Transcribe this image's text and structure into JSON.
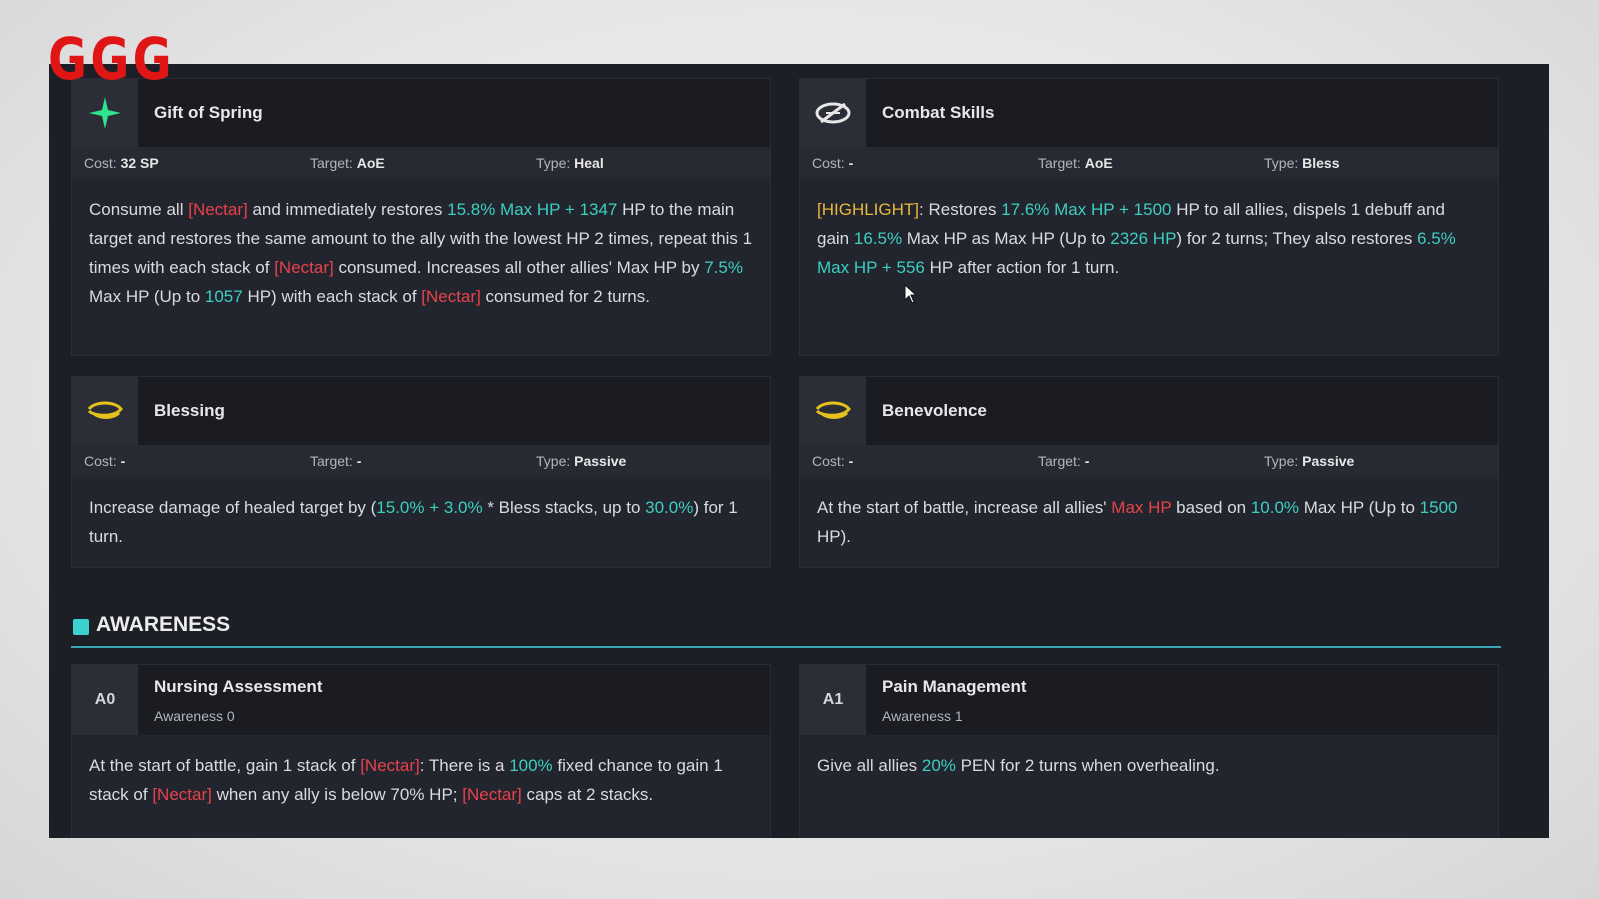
{
  "watermark": "GGG",
  "skills": [
    {
      "icon": "green-sparkle-icon",
      "title": "Gift of Spring",
      "cost_label": "Cost:",
      "cost": "32 SP",
      "target_label": "Target:",
      "target": "AoE",
      "type_label": "Type:",
      "type": "Heal",
      "desc": [
        {
          "t": "Consume all "
        },
        {
          "t": "[Nectar]",
          "c": "r"
        },
        {
          "t": " and immediately restores "
        },
        {
          "t": "15.8% Max HP + 1347",
          "c": "g"
        },
        {
          "t": " HP to the main target and restores the same amount to the ally with the lowest HP 2 times, repeat this 1 times with each stack of "
        },
        {
          "t": "[Nectar]",
          "c": "r"
        },
        {
          "t": " consumed. Increases all other allies' Max HP by "
        },
        {
          "t": "7.5%",
          "c": "g"
        },
        {
          "t": " Max HP (Up to "
        },
        {
          "t": "1057",
          "c": "g"
        },
        {
          "t": " HP) with each stack of "
        },
        {
          "t": "[Nectar]",
          "c": "r"
        },
        {
          "t": " consumed for 2 turns."
        }
      ]
    },
    {
      "icon": "crossed-target-icon",
      "title": "Combat Skills",
      "cost_label": "Cost:",
      "cost": "-",
      "target_label": "Target:",
      "target": "AoE",
      "type_label": "Type:",
      "type": "Bless",
      "desc": [
        {
          "t": "[HIGHLIGHT]",
          "c": "y"
        },
        {
          "t": ": Restores "
        },
        {
          "t": "17.6% Max HP + 1500",
          "c": "g"
        },
        {
          "t": " HP to all allies, dispels 1 debuff and gain "
        },
        {
          "t": "16.5%",
          "c": "g"
        },
        {
          "t": " Max HP as Max HP (Up to "
        },
        {
          "t": "2326 HP",
          "c": "g"
        },
        {
          "t": ") for 2 turns; They also restores "
        },
        {
          "t": "6.5% Max HP + 556",
          "c": "g"
        },
        {
          "t": " HP after action for 1 turn."
        }
      ]
    },
    {
      "icon": "yellow-loop-icon",
      "title": "Blessing",
      "cost_label": "Cost:",
      "cost": "-",
      "target_label": "Target:",
      "target": "-",
      "type_label": "Type:",
      "type": "Passive",
      "desc": [
        {
          "t": "Increase damage of healed target by ("
        },
        {
          "t": "15.0% + 3.0%",
          "c": "g"
        },
        {
          "t": " * Bless stacks, up to "
        },
        {
          "t": "30.0%",
          "c": "g"
        },
        {
          "t": ") for 1 turn."
        }
      ]
    },
    {
      "icon": "yellow-loop-icon",
      "title": "Benevolence",
      "cost_label": "Cost:",
      "cost": "-",
      "target_label": "Target:",
      "target": "-",
      "type_label": "Type:",
      "type": "Passive",
      "desc": [
        {
          "t": "At the start of battle, increase all allies' "
        },
        {
          "t": "Max HP",
          "c": "r"
        },
        {
          "t": " based on "
        },
        {
          "t": "10.0%",
          "c": "g"
        },
        {
          "t": " Max HP (Up to "
        },
        {
          "t": "1500",
          "c": "g"
        },
        {
          "t": " HP)."
        }
      ]
    }
  ],
  "awareness_section": {
    "title": "AWARENESS",
    "items": [
      {
        "tag": "A0",
        "title": "Nursing Assessment",
        "subtitle": "Awareness 0",
        "desc": [
          {
            "t": "At the start of battle, gain 1 stack of "
          },
          {
            "t": "[Nectar]",
            "c": "r"
          },
          {
            "t": ": There is a "
          },
          {
            "t": "100%",
            "c": "g"
          },
          {
            "t": " fixed chance to gain 1 stack of "
          },
          {
            "t": "[Nectar]",
            "c": "r"
          },
          {
            "t": " when any ally is below 70% HP; "
          },
          {
            "t": "[Nectar]",
            "c": "r"
          },
          {
            "t": " caps at 2 stacks."
          }
        ]
      },
      {
        "tag": "A1",
        "title": "Pain Management",
        "subtitle": "Awareness 1",
        "desc": [
          {
            "t": "Give all allies "
          },
          {
            "t": "20%",
            "c": "g"
          },
          {
            "t": " PEN for 2 turns when overhealing."
          }
        ]
      }
    ]
  },
  "colors": {
    "highlight_green": "#3ccfc0",
    "highlight_red": "#e8414a",
    "highlight_yellow": "#e9b93c",
    "section_accent": "#3ecfd0",
    "watermark_red": "#e01616"
  }
}
